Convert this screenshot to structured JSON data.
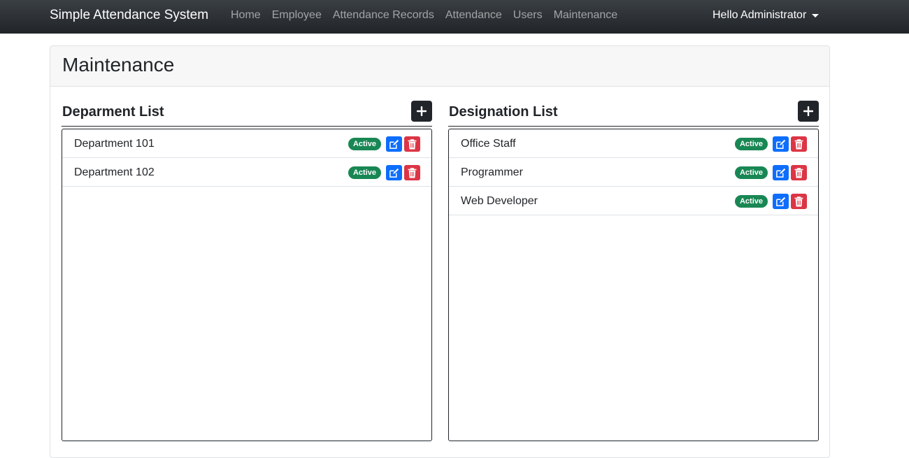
{
  "app": {
    "brand": "Simple Attendance System",
    "nav": [
      "Home",
      "Employee",
      "Attendance Records",
      "Attendance",
      "Users",
      "Maintenance"
    ],
    "user_menu": "Hello Administrator"
  },
  "page": {
    "title": "Maintenance"
  },
  "departments": {
    "title": "Deparment List",
    "items": [
      {
        "name": "Department 101",
        "status": "Active"
      },
      {
        "name": "Department 102",
        "status": "Active"
      }
    ]
  },
  "designations": {
    "title": "Designation List",
    "items": [
      {
        "name": "Office Staff",
        "status": "Active"
      },
      {
        "name": "Programmer",
        "status": "Active"
      },
      {
        "name": "Web Developer",
        "status": "Active"
      }
    ]
  },
  "colors": {
    "navbar": "#212529",
    "active_badge": "#198754",
    "edit_button": "#0d6efd",
    "delete_button": "#dc3545"
  },
  "icons": {
    "add": "plus-icon",
    "edit": "edit-icon",
    "delete": "trash-icon"
  }
}
